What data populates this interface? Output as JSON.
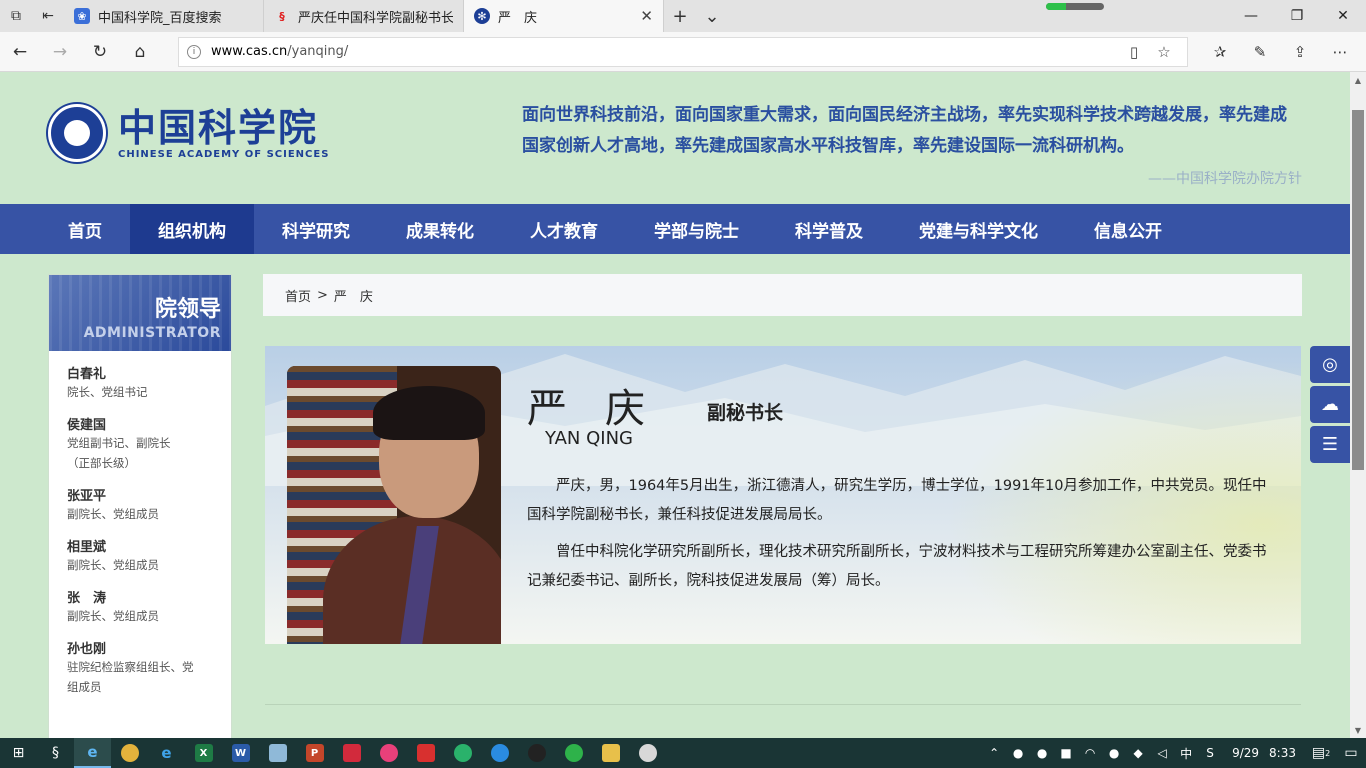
{
  "browser": {
    "tabs": [
      {
        "label": "中国科学院_百度搜索",
        "favicon": "paw-icon",
        "active": false
      },
      {
        "label": "严庆任中国科学院副秘书长",
        "favicon": "sohu-icon",
        "active": false
      },
      {
        "label": "严　庆",
        "favicon": "cas-icon",
        "active": true
      }
    ],
    "url_host": "www.cas.cn",
    "url_path": "/yanqing/",
    "load_progress": 0.35
  },
  "header": {
    "logo_cn": "中国科学院",
    "logo_en": "CHINESE ACADEMY OF SCIENCES",
    "motto": "面向世界科技前沿，面向国家重大需求，面向国民经济主战场，率先实现科学技术跨越发展，率先建成国家创新人才高地，率先建成国家高水平科技智库，率先建设国际一流科研机构。",
    "motto_source": "——中国科学院办院方针"
  },
  "nav": {
    "items": [
      "首页",
      "组织机构",
      "科学研究",
      "成果转化",
      "人才教育",
      "学部与院士",
      "科学普及",
      "党建与科学文化",
      "信息公开"
    ],
    "active_index": 1
  },
  "sidebar": {
    "title": "院领导",
    "subtitle": "ADMINISTRATOR",
    "items": [
      {
        "name": "白春礼",
        "position": "院长、党组书记"
      },
      {
        "name": "侯建国",
        "position": "党组副书记、副院长（正部长级）"
      },
      {
        "name": "张亚平",
        "position": "副院长、党组成员"
      },
      {
        "name": "相里斌",
        "position": "副院长、党组成员"
      },
      {
        "name": "张　涛",
        "position": "副院长、党组成员"
      },
      {
        "name": "孙也刚",
        "position": "驻院纪检监察组组长、党组成员"
      }
    ]
  },
  "breadcrumb": {
    "home": "首页",
    "sep": ">",
    "current": "严　庆"
  },
  "profile": {
    "name": "严庆",
    "title": "副秘书长",
    "pinyin": "YAN QING",
    "para1": "严庆，男，1964年5月出生，浙江德清人，研究生学历，博士学位，1991年10月参加工作，中共党员。现任中国科学院副秘书长，兼任科技促进发展局局长。",
    "para2": "曾任中科院化学研究所副所长，理化技术研究所副所长，宁波材料技术与工程研究所筹建办公室副主任、党委书记兼纪委书记、副所长，院科技促进发展局（筹）局长。"
  },
  "taskbar": {
    "time": "8:33",
    "date": "9/29",
    "ime": "中",
    "notif_count": "2"
  },
  "colors": {
    "page_bg": "#cde8cd",
    "nav_bg": "#3753a5",
    "nav_active": "#1e3a8f",
    "brand": "#1d3f96",
    "motto": "#2a4fa0"
  }
}
